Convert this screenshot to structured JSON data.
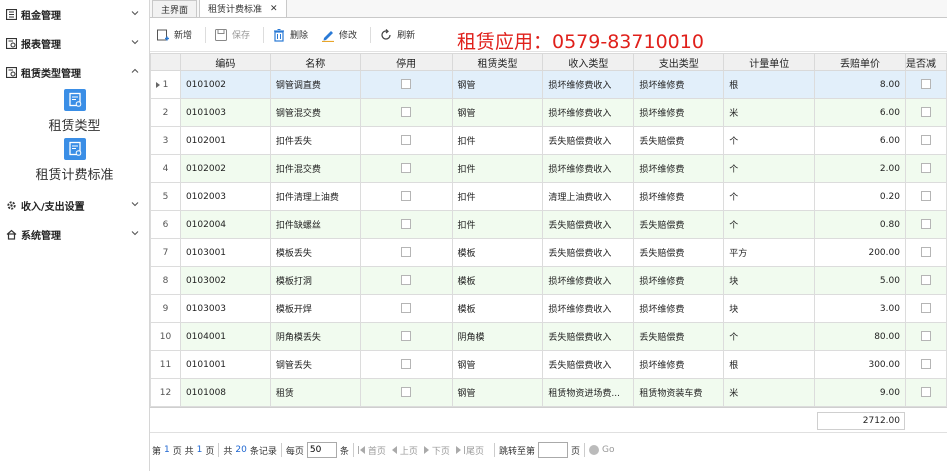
{
  "sidebar": {
    "menus": [
      {
        "label": "租金管理",
        "icon": "ledger-icon",
        "expanded": false
      },
      {
        "label": "报表管理",
        "icon": "report-icon",
        "expanded": false
      },
      {
        "label": "租赁类型管理",
        "icon": "report-icon",
        "expanded": true
      },
      {
        "label": "收入/支出设置",
        "icon": "gear-icon",
        "expanded": false
      },
      {
        "label": "系统管理",
        "icon": "home-icon",
        "expanded": false
      }
    ],
    "submenu": [
      {
        "label": "租赁类型",
        "icon": "doc-icon"
      },
      {
        "label": "租赁计费标准",
        "icon": "doc-icon"
      }
    ]
  },
  "tabs": [
    {
      "label": "主界面",
      "active": false
    },
    {
      "label": "租赁计费标准",
      "active": true,
      "closable": true
    }
  ],
  "toolbar": {
    "add_label": "新增",
    "save_label": "保存",
    "delete_label": "删除",
    "edit_label": "修改",
    "refresh_label": "刷新",
    "banner": "租赁应用：0579-83710010"
  },
  "grid": {
    "columns": [
      "编码",
      "名称",
      "停用",
      "租赁类型",
      "收入类型",
      "支出类型",
      "计量单位",
      "丢赔单价",
      "是否减"
    ],
    "rows": [
      {
        "idx": "1",
        "code": "0101002",
        "name": "钢管调直费",
        "type": "钢管",
        "income": "损坏维修费收入",
        "expense": "损坏维修费",
        "unit": "根",
        "price": "8.00"
      },
      {
        "idx": "2",
        "code": "0101003",
        "name": "钢管混交费",
        "type": "钢管",
        "income": "损坏维修费收入",
        "expense": "损坏维修费",
        "unit": "米",
        "price": "6.00"
      },
      {
        "idx": "3",
        "code": "0102001",
        "name": "扣件丢失",
        "type": "扣件",
        "income": "丢失赔偿费收入",
        "expense": "丢失赔偿费",
        "unit": "个",
        "price": "6.00"
      },
      {
        "idx": "4",
        "code": "0102002",
        "name": "扣件混交费",
        "type": "扣件",
        "income": "损坏维修费收入",
        "expense": "损坏维修费",
        "unit": "个",
        "price": "2.00"
      },
      {
        "idx": "5",
        "code": "0102003",
        "name": "扣件清理上油费",
        "type": "扣件",
        "income": "清理上油费收入",
        "expense": "损坏维修费",
        "unit": "个",
        "price": "0.20"
      },
      {
        "idx": "6",
        "code": "0102004",
        "name": "扣件缺螺丝",
        "type": "扣件",
        "income": "丢失赔偿费收入",
        "expense": "丢失赔偿费",
        "unit": "个",
        "price": "0.80"
      },
      {
        "idx": "7",
        "code": "0103001",
        "name": "模板丢失",
        "type": "模板",
        "income": "丢失赔偿费收入",
        "expense": "丢失赔偿费",
        "unit": "平方",
        "price": "200.00"
      },
      {
        "idx": "8",
        "code": "0103002",
        "name": "模板打洞",
        "type": "模板",
        "income": "损坏维修费收入",
        "expense": "损坏维修费",
        "unit": "块",
        "price": "5.00"
      },
      {
        "idx": "9",
        "code": "0103003",
        "name": "模板开焊",
        "type": "模板",
        "income": "损坏维修费收入",
        "expense": "损坏维修费",
        "unit": "块",
        "price": "3.00"
      },
      {
        "idx": "10",
        "code": "0104001",
        "name": "阴角模丢失",
        "type": "阴角模",
        "income": "丢失赔偿费收入",
        "expense": "丢失赔偿费",
        "unit": "个",
        "price": "80.00"
      },
      {
        "idx": "11",
        "code": "0101001",
        "name": "钢管丢失",
        "type": "钢管",
        "income": "丢失赔偿费收入",
        "expense": "损坏维修费",
        "unit": "根",
        "price": "300.00"
      },
      {
        "idx": "12",
        "code": "0101008",
        "name": "租赁",
        "type": "钢管",
        "income": "租赁物资进场费...",
        "expense": "租赁物资装车费",
        "unit": "米",
        "price": "9.00"
      }
    ],
    "total": "2712.00"
  },
  "pager": {
    "prefix": "第",
    "page": "1",
    "page_sep": "页 共",
    "pages": "1",
    "page_suffix": "页",
    "total_prefix": "共",
    "records": "20",
    "records_suffix": "条记录",
    "per_page_prefix": "每页",
    "per_page": "50",
    "per_page_suffix": "条",
    "first": "首页",
    "prev": "上页",
    "next": "下页",
    "last": "尾页",
    "jump_prefix": "跳转至第",
    "jump_value": "",
    "jump_suffix": "页",
    "go": "Go"
  },
  "colors": {
    "accent": "#3a8ee6",
    "banner": "#e0201b",
    "row_alt": "#f1fbef",
    "row_selected": "#e2effa"
  }
}
